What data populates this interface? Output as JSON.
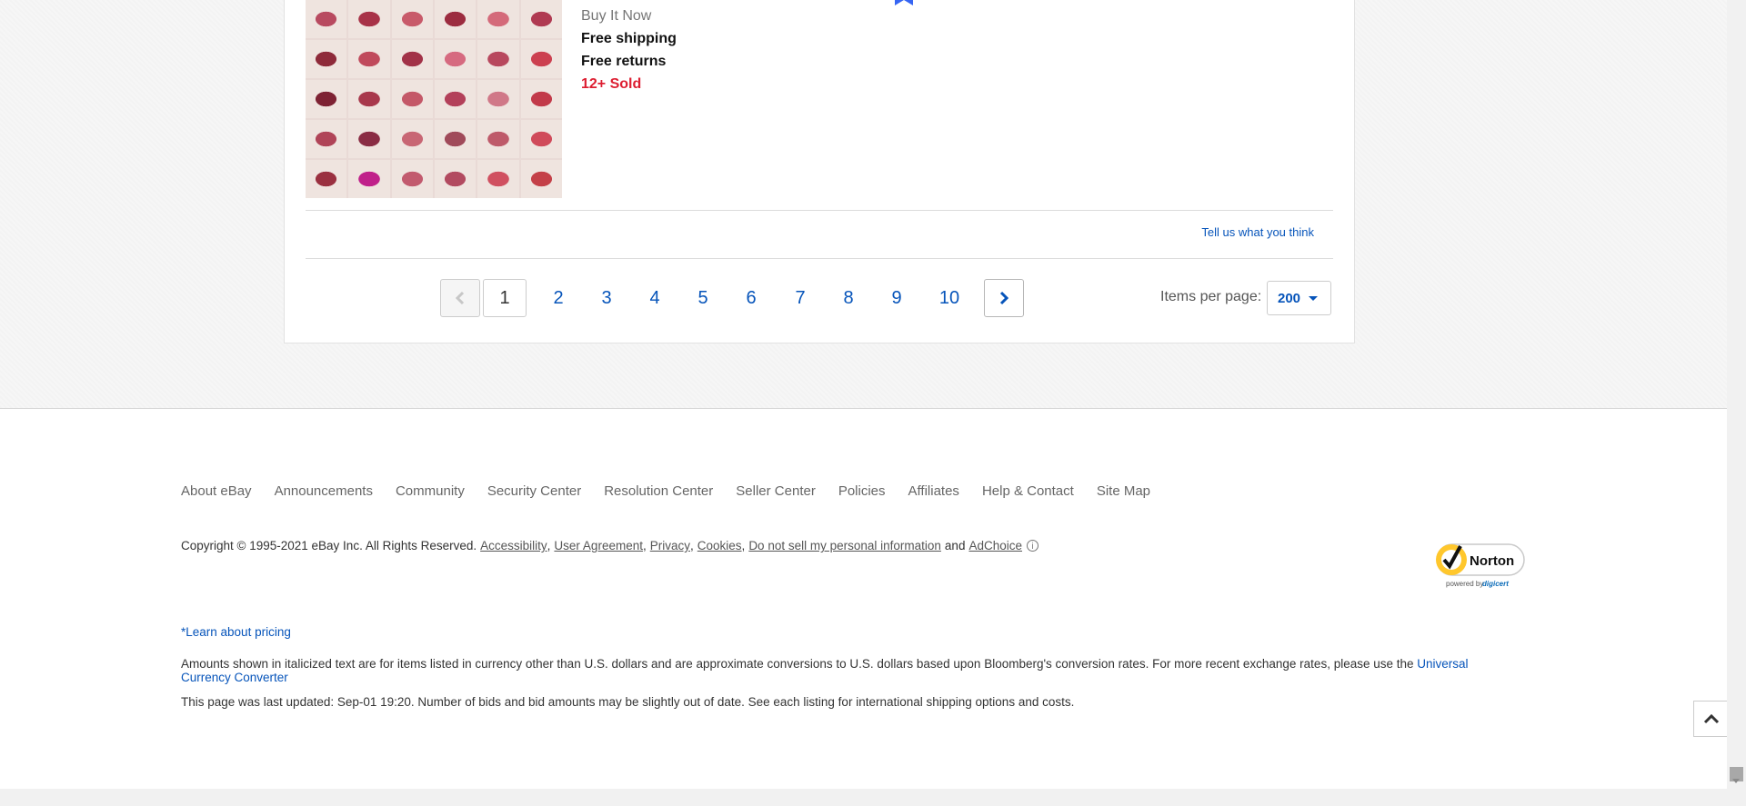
{
  "listing": {
    "format": "Buy It Now",
    "shipping": "Free shipping",
    "returns": "Free returns",
    "sold": "12+ Sold",
    "thumbnail_colors": [
      "#b84a60",
      "#a83248",
      "#c85a6a",
      "#9c2c40",
      "#d46a7a",
      "#b03a52",
      "#8e2a3a",
      "#c04a5c",
      "#a23248",
      "#d66a80",
      "#b8485e",
      "#cc4050",
      "#7e2234",
      "#a8384c",
      "#c45868",
      "#b3405a",
      "#d07888",
      "#c23a4a",
      "#b04458",
      "#8a2c44",
      "#c86674",
      "#a04a5a",
      "#be5a6a",
      "#d04a5a",
      "#9a3040",
      "#c0208a",
      "#c25a6e",
      "#b24a60",
      "#d05060",
      "#c44048"
    ]
  },
  "feedback": {
    "link": "Tell us what you think"
  },
  "pagination": {
    "current_page": "1",
    "pages": [
      "1",
      "2",
      "3",
      "4",
      "5",
      "6",
      "7",
      "8",
      "9",
      "10"
    ],
    "items_per_page_label": "Items per page:",
    "items_per_page_value": "200"
  },
  "footer": {
    "nav": [
      "About eBay",
      "Announcements",
      "Community",
      "Security Center",
      "Resolution Center",
      "Seller Center",
      "Policies",
      "Affiliates",
      "Help & Contact",
      "Site Map"
    ],
    "copyright": "Copyright © 1995-2021 eBay Inc. All Rights Reserved.",
    "legal_links": {
      "accessibility": "Accessibility",
      "user_agreement": "User Agreement",
      "privacy": "Privacy",
      "cookies": "Cookies",
      "do_not_sell": "Do not sell my personal information",
      "and": "and",
      "adchoice": "AdChoice"
    },
    "norton": {
      "name": "Norton",
      "powered_by": "powered by",
      "digicert": "digicert"
    },
    "pricing_link": "*Learn about pricing",
    "currency_note": "Amounts shown in italicized text are for items listed in currency other than U.S. dollars and are approximate conversions to U.S. dollars based upon Bloomberg's conversion rates. For more recent exchange rates, please use the",
    "currency_link": "Universal Currency Converter",
    "updated_note": "This page was last updated:  Sep-01 19:20. Number of bids and bid amounts may be slightly out of date. See each listing for international shipping options and costs."
  },
  "colors": {
    "link": "#0654ba",
    "sold": "#dd1e31",
    "text": "#333333"
  }
}
